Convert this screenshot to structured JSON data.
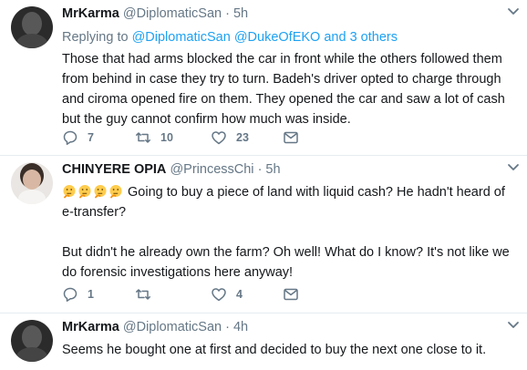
{
  "tweets": [
    {
      "name": "MrKarma",
      "handle": "@DiplomaticSan",
      "time": "· 5h",
      "replying_prefix": "Replying to",
      "replying_users": [
        "@DiplomaticSan",
        "@DukeOfEKO"
      ],
      "replying_suffix": "and 3 others",
      "text": "Those that had arms blocked the car in front while the others followed them from behind in case they try to turn. Badeh's driver opted to charge through and ciroma opened fire on them. They opened the car and saw a lot of cash but the guy cannot confirm how much was inside.",
      "reply_count": "7",
      "retweet_count": "10",
      "like_count": "23"
    },
    {
      "name": "CHINYERE OPIA",
      "handle": "@PrincessChi",
      "time": "· 5h",
      "emojis": [
        "thinking-face",
        "thinking-face",
        "thinking-face",
        "thinking-face"
      ],
      "text": "Going to buy a piece of land with liquid cash? He hadn't heard of e-transfer?\n\nBut didn't he already own the farm? Oh well! What do I know? It's not like we do forensic investigations here anyway!",
      "reply_count": "1",
      "retweet_count": "",
      "like_count": "4"
    },
    {
      "name": "MrKarma",
      "handle": "@DiplomaticSan",
      "time": "· 4h",
      "text": "Seems he bought one at first and decided to buy the next one close to it."
    }
  ],
  "colors": {
    "link": "#1da1f2",
    "muted": "#657786",
    "divider": "#e6ecf0"
  },
  "icons": [
    "caret-down-icon",
    "reply-icon",
    "retweet-icon",
    "like-icon",
    "message-icon",
    "thinking-face-emoji"
  ]
}
